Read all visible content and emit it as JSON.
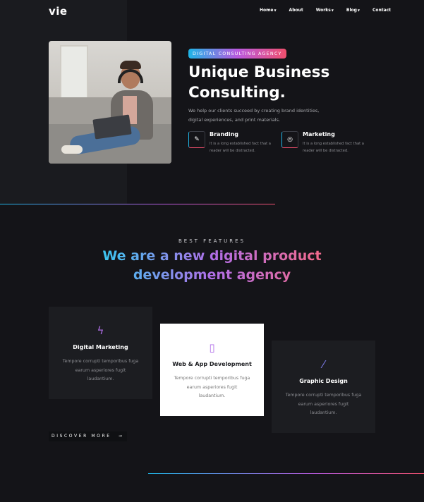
{
  "header": {
    "logo": "vie",
    "nav": [
      {
        "label": "Home",
        "dropdown": true
      },
      {
        "label": "About",
        "dropdown": false
      },
      {
        "label": "Works",
        "dropdown": true
      },
      {
        "label": "Blog",
        "dropdown": true
      },
      {
        "label": "Contact",
        "dropdown": false
      }
    ]
  },
  "hero": {
    "badge": "DIGITAL CONSULTING AGENCY",
    "title": "Unique Business Consulting.",
    "description": "We help our clients succeed by creating brand identities, digital experiences, and print materials.",
    "features": [
      {
        "title": "Branding",
        "text": "It is a long established fact that a reader will be distracted.",
        "icon": "brush-icon"
      },
      {
        "title": "Marketing",
        "text": "It is a long established fact that a reader will be distracted.",
        "icon": "target-icon"
      }
    ]
  },
  "features_section": {
    "kicker": "BEST FEATURES",
    "headline_line1": "We are a new digital product",
    "headline_line2": "development agency",
    "cards": [
      {
        "title": "Digital Marketing",
        "text": "Tempore corrupti temporibus fuga earum asperiores fugit laudantium.",
        "icon": "lightning-icon"
      },
      {
        "title": "Web & App Development",
        "text": "Tempore corrupti temporibus fuga earum asperiores fugit laudantium.",
        "icon": "mobile-icon"
      },
      {
        "title": "Graphic Design",
        "text": "Tempore corrupti temporibus fuga earum asperiores fugit laudantium.",
        "icon": "magic-wand-icon"
      }
    ],
    "cta": "DISCOVER MORE",
    "cta_arrow": "➞"
  },
  "colors": {
    "background": "#141418",
    "panel": "#1a1b1f",
    "card": "#1c1d21",
    "accent_blue": "#1fb5e6",
    "accent_purple": "#b95ae0",
    "accent_pink": "#f0506e"
  }
}
